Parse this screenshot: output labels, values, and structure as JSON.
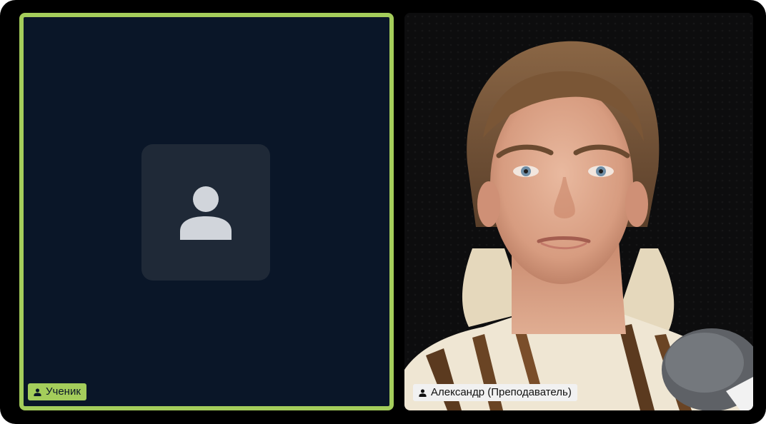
{
  "participants": [
    {
      "name": "Ученик",
      "camera_on": false,
      "active_speaker": true,
      "icon": "person-icon"
    },
    {
      "name": "Александр (Преподаватель)",
      "camera_on": true,
      "active_speaker": false,
      "icon": "person-icon"
    }
  ],
  "colors": {
    "background": "#000000",
    "active_border": "#a4cd5b",
    "empty_tile": "#0a1628",
    "avatar_placeholder": "#1f2937",
    "avatar_glyph": "#d1d5db",
    "teacher_label_bg": "#f1f1f1"
  }
}
